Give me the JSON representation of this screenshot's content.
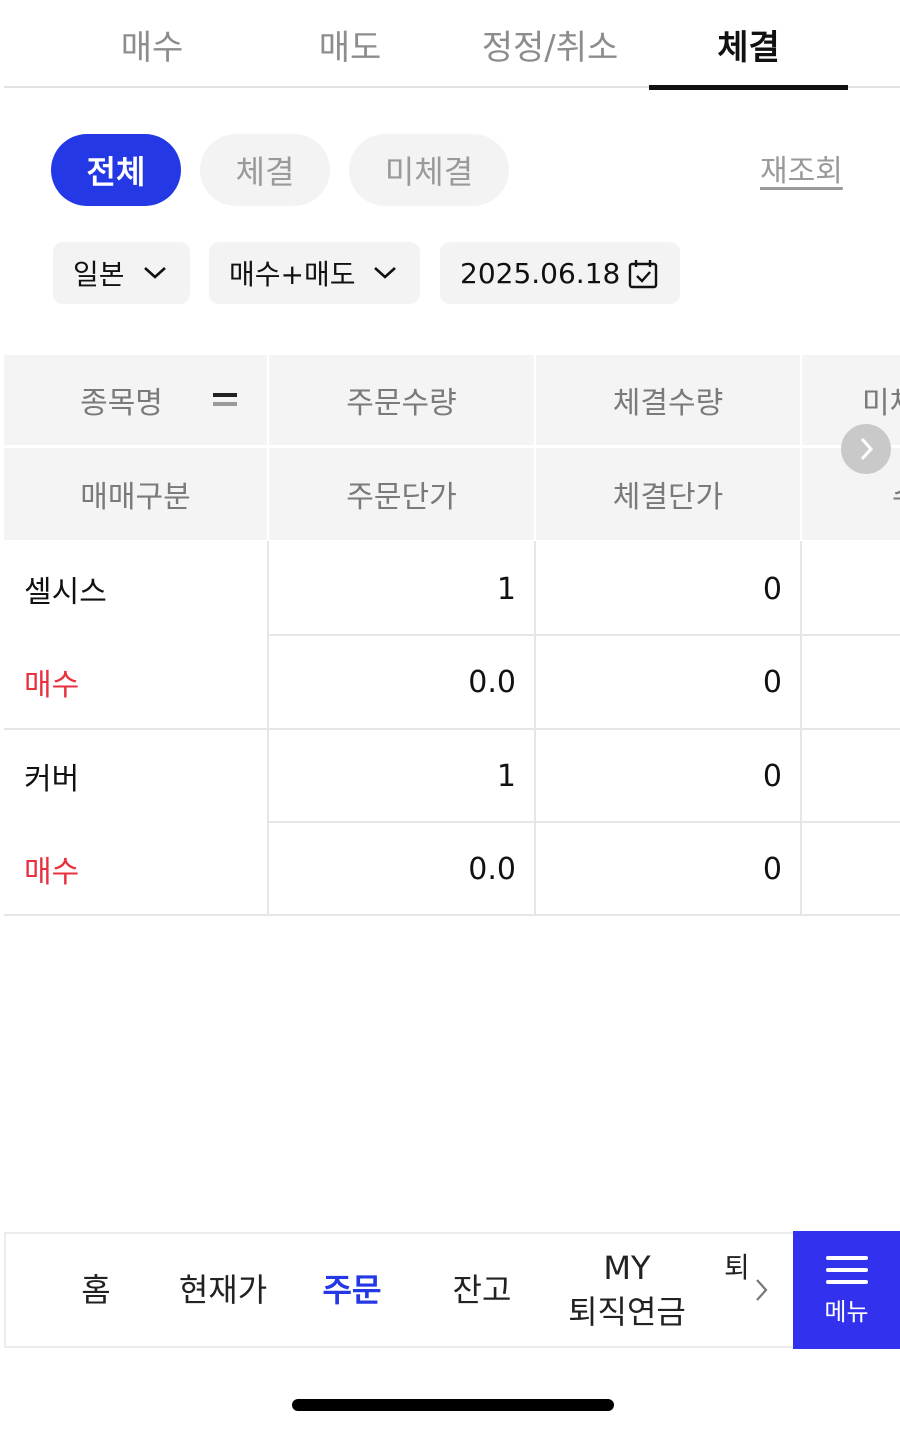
{
  "tabs": [
    {
      "label": "매수",
      "active": false
    },
    {
      "label": "매도",
      "active": false
    },
    {
      "label": "정정/취소",
      "active": false
    },
    {
      "label": "체결",
      "active": true
    }
  ],
  "filters": {
    "chips": [
      {
        "label": "전체",
        "active": true
      },
      {
        "label": "체결",
        "active": false
      },
      {
        "label": "미체결",
        "active": false
      }
    ],
    "refresh_label": "재조회",
    "market": "일본",
    "side": "매수+매도",
    "date": "2025.06.18"
  },
  "table": {
    "headers_row1": [
      "종목명",
      "주문수량",
      "체결수량",
      "미체"
    ],
    "headers_row2": [
      "매매구분",
      "주문단가",
      "체결단가",
      "수"
    ],
    "rows": [
      {
        "name": "셀시스",
        "type": "매수",
        "order_qty": "1",
        "order_price": "0.0",
        "filled_qty": "0",
        "filled_price": "0"
      },
      {
        "name": "커버",
        "type": "매수",
        "order_qty": "1",
        "order_price": "0.0",
        "filled_qty": "0",
        "filled_price": "0"
      }
    ]
  },
  "bottom_nav": {
    "items": [
      {
        "label": "홈",
        "active": false
      },
      {
        "label": "현재가",
        "active": false
      },
      {
        "label": "주문",
        "active": true
      },
      {
        "label": "잔고",
        "active": false
      },
      {
        "label": "MY 퇴직연금",
        "line1": "MY",
        "line2": "퇴직연금",
        "active": false
      },
      {
        "label": "퇴",
        "active": false
      }
    ],
    "menu_label": "메뉴"
  },
  "icons": {
    "dropdown": "chevron-down-icon",
    "calendar": "calendar-check-icon",
    "scroll_right": "chevron-right-icon",
    "sort": "sort-toggle-icon",
    "menu": "hamburger-menu-icon"
  },
  "colors": {
    "accent": "#2438e5",
    "buy": "#e8313f",
    "menu_bg": "#3232ee"
  }
}
